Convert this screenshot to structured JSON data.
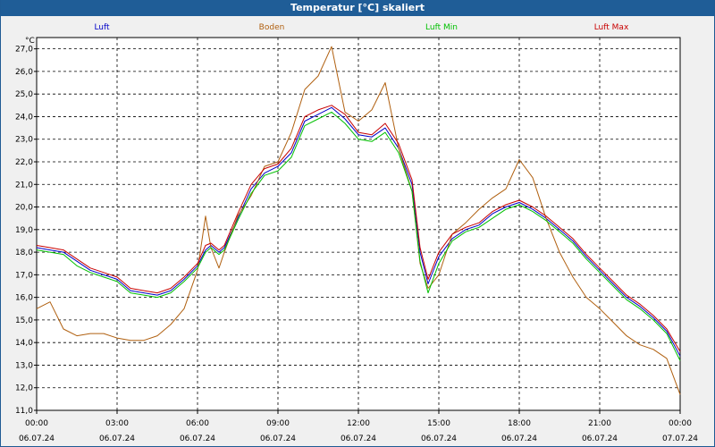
{
  "window": {
    "title": "Temperatur [°C] skaliert"
  },
  "chart_data": {
    "type": "line",
    "title": "Temperatur [°C] skaliert",
    "ylabel": "°C",
    "ylim": [
      11.0,
      27.5
    ],
    "grid": true,
    "legend_position": "top",
    "yticks": [
      11.0,
      12.0,
      13.0,
      14.0,
      15.0,
      16.0,
      17.0,
      18.0,
      19.0,
      20.0,
      21.0,
      22.0,
      23.0,
      24.0,
      25.0,
      26.0,
      27.0
    ],
    "ytick_labels": [
      "11,0",
      "12,0",
      "13,0",
      "14,0",
      "15,0",
      "16,0",
      "17,0",
      "18,0",
      "19,0",
      "20,0",
      "21,0",
      "22,0",
      "23,0",
      "24,0",
      "25,0",
      "26,0",
      "27,0"
    ],
    "xticks": [
      {
        "time": "00:00",
        "date": "06.07.24"
      },
      {
        "time": "03:00",
        "date": "06.07.24"
      },
      {
        "time": "06:00",
        "date": "06.07.24"
      },
      {
        "time": "09:00",
        "date": "06.07.24"
      },
      {
        "time": "12:00",
        "date": "06.07.24"
      },
      {
        "time": "15:00",
        "date": "06.07.24"
      },
      {
        "time": "18:00",
        "date": "06.07.24"
      },
      {
        "time": "21:00",
        "date": "06.07.24"
      },
      {
        "time": "00:00",
        "date": "07.07.24"
      }
    ],
    "x_hours": [
      0,
      0.5,
      1,
      1.5,
      2,
      2.5,
      3,
      3.5,
      4,
      4.5,
      5,
      5.5,
      6,
      6.3,
      6.5,
      6.8,
      7,
      7.5,
      8,
      8.5,
      9,
      9.5,
      10,
      10.5,
      11,
      11.5,
      12,
      12.5,
      13,
      13.5,
      14,
      14.3,
      14.6,
      15,
      15.5,
      16,
      16.5,
      17,
      17.5,
      18,
      18.5,
      19,
      19.5,
      20,
      20.5,
      21,
      21.5,
      22,
      22.5,
      23,
      23.5,
      24
    ],
    "series": [
      {
        "name": "Luft",
        "color": "#0000c8",
        "values": [
          18.2,
          18.1,
          18.0,
          17.6,
          17.2,
          17.0,
          16.8,
          16.3,
          16.2,
          16.1,
          16.3,
          16.8,
          17.4,
          18.1,
          18.3,
          18.0,
          18.2,
          19.5,
          20.8,
          21.5,
          21.8,
          22.4,
          23.8,
          24.1,
          24.4,
          23.9,
          23.2,
          23.1,
          23.5,
          22.6,
          21.0,
          18.0,
          16.6,
          17.8,
          18.6,
          19.0,
          19.2,
          19.7,
          20.0,
          20.2,
          19.9,
          19.5,
          19.0,
          18.5,
          17.8,
          17.2,
          16.6,
          16.0,
          15.6,
          15.1,
          14.5,
          13.4
        ]
      },
      {
        "name": "Boden",
        "color": "#b06010",
        "values": [
          15.5,
          15.8,
          14.6,
          14.3,
          14.4,
          14.4,
          14.2,
          14.1,
          14.1,
          14.3,
          14.8,
          15.5,
          17.2,
          19.6,
          18.2,
          17.3,
          18.0,
          19.6,
          20.5,
          21.8,
          22.0,
          23.3,
          25.2,
          25.8,
          27.1,
          24.2,
          23.8,
          24.3,
          25.5,
          22.6,
          20.7,
          17.5,
          16.4,
          17.0,
          18.8,
          19.3,
          19.9,
          20.4,
          20.8,
          22.1,
          21.3,
          19.5,
          18.0,
          16.9,
          16.0,
          15.5,
          14.9,
          14.3,
          13.9,
          13.7,
          13.3,
          11.7
        ]
      },
      {
        "name": "Luft Min",
        "color": "#00c000",
        "values": [
          18.1,
          18.0,
          17.9,
          17.4,
          17.1,
          16.9,
          16.7,
          16.2,
          16.1,
          16.0,
          16.2,
          16.7,
          17.3,
          18.0,
          18.2,
          17.9,
          18.1,
          19.4,
          20.6,
          21.4,
          21.6,
          22.2,
          23.6,
          23.9,
          24.2,
          23.7,
          23.0,
          22.9,
          23.3,
          22.4,
          20.7,
          17.6,
          16.2,
          17.5,
          18.5,
          18.9,
          19.1,
          19.5,
          19.9,
          20.1,
          19.8,
          19.4,
          18.9,
          18.4,
          17.7,
          17.1,
          16.5,
          15.9,
          15.5,
          15.0,
          14.4,
          13.2
        ]
      },
      {
        "name": "Luft Max",
        "color": "#c80000",
        "values": [
          18.3,
          18.2,
          18.1,
          17.7,
          17.3,
          17.1,
          16.9,
          16.4,
          16.3,
          16.2,
          16.4,
          16.9,
          17.5,
          18.3,
          18.4,
          18.1,
          18.3,
          19.7,
          21.0,
          21.7,
          21.9,
          22.6,
          24.0,
          24.3,
          24.5,
          24.1,
          23.3,
          23.2,
          23.7,
          22.8,
          21.2,
          18.2,
          16.8,
          18.0,
          18.8,
          19.1,
          19.3,
          19.8,
          20.1,
          20.3,
          20.0,
          19.6,
          19.1,
          18.6,
          17.9,
          17.3,
          16.7,
          16.1,
          15.7,
          15.2,
          14.6,
          13.6
        ]
      }
    ]
  }
}
